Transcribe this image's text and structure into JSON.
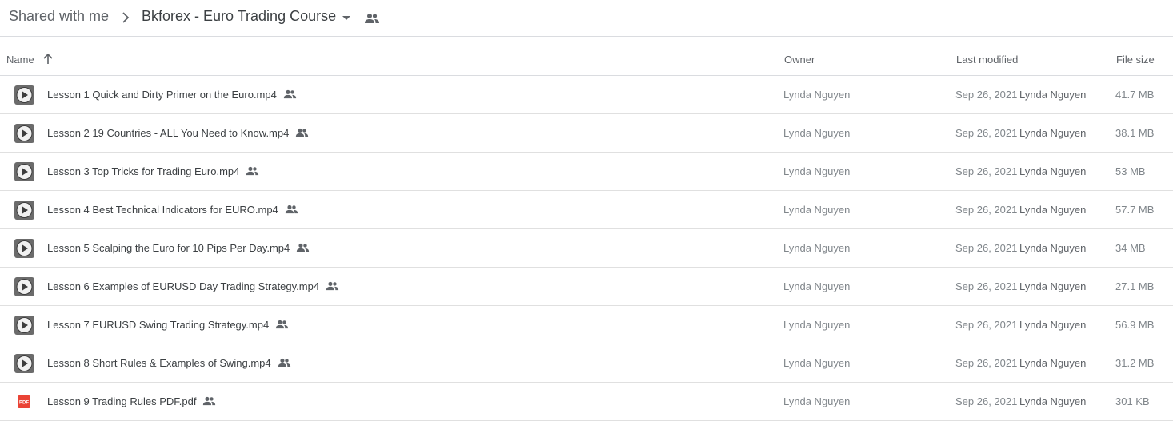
{
  "breadcrumb": {
    "root": "Shared with me",
    "current": "Bkforex - Euro Trading Course"
  },
  "icons": {
    "separator": "chevron-right-icon",
    "caret": "caret-down-icon",
    "shared": "people-icon",
    "sort": "arrow-up-icon",
    "video": "play-icon",
    "pdf": "pdf-icon"
  },
  "columns": {
    "name": "Name",
    "owner": "Owner",
    "last_modified": "Last modified",
    "file_size": "File size"
  },
  "files": [
    {
      "name": "Lesson 1 Quick and Dirty Primer on the Euro.mp4",
      "type": "video",
      "owner": "Lynda Nguyen",
      "modified": "Sep 26, 2021",
      "modified_by": "Lynda Nguyen",
      "size": "41.7 MB"
    },
    {
      "name": "Lesson 2 19 Countries - ALL You Need to Know.mp4",
      "type": "video",
      "owner": "Lynda Nguyen",
      "modified": "Sep 26, 2021",
      "modified_by": "Lynda Nguyen",
      "size": "38.1 MB"
    },
    {
      "name": "Lesson 3 Top Tricks for Trading Euro.mp4",
      "type": "video",
      "owner": "Lynda Nguyen",
      "modified": "Sep 26, 2021",
      "modified_by": "Lynda Nguyen",
      "size": "53 MB"
    },
    {
      "name": "Lesson 4 Best Technical Indicators for EURO.mp4",
      "type": "video",
      "owner": "Lynda Nguyen",
      "modified": "Sep 26, 2021",
      "modified_by": "Lynda Nguyen",
      "size": "57.7 MB"
    },
    {
      "name": "Lesson 5 Scalping the Euro for 10 Pips Per Day.mp4",
      "type": "video",
      "owner": "Lynda Nguyen",
      "modified": "Sep 26, 2021",
      "modified_by": "Lynda Nguyen",
      "size": "34 MB"
    },
    {
      "name": "Lesson 6 Examples of EURUSD Day Trading Strategy.mp4",
      "type": "video",
      "owner": "Lynda Nguyen",
      "modified": "Sep 26, 2021",
      "modified_by": "Lynda Nguyen",
      "size": "27.1 MB"
    },
    {
      "name": "Lesson 7 EURUSD Swing Trading Strategy.mp4",
      "type": "video",
      "owner": "Lynda Nguyen",
      "modified": "Sep 26, 2021",
      "modified_by": "Lynda Nguyen",
      "size": "56.9 MB"
    },
    {
      "name": "Lesson 8 Short Rules & Examples of Swing.mp4",
      "type": "video",
      "owner": "Lynda Nguyen",
      "modified": "Sep 26, 2021",
      "modified_by": "Lynda Nguyen",
      "size": "31.2 MB"
    },
    {
      "name": "Lesson 9 Trading Rules PDF.pdf",
      "type": "pdf",
      "owner": "Lynda Nguyen",
      "modified": "Sep 26, 2021",
      "modified_by": "Lynda Nguyen",
      "size": "301 KB"
    }
  ],
  "colors": {
    "text_primary": "#3c4043",
    "text_secondary": "#80868b",
    "divider": "#e0e0e0",
    "pdf_red": "#ea4335",
    "video_badge": "#5f6368"
  }
}
